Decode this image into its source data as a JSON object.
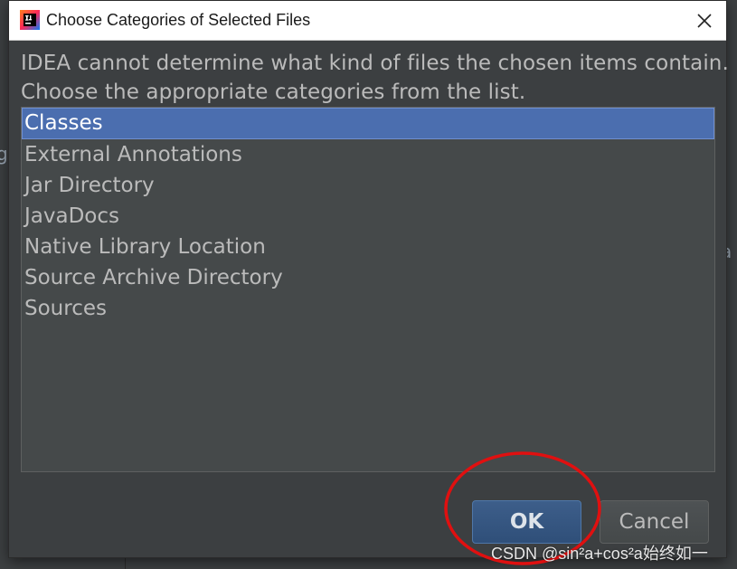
{
  "dialog": {
    "title": "Choose Categories of Selected Files",
    "app_icon": "intellij-idea-icon",
    "close_icon": "close-icon",
    "message_line1": "IDEA cannot determine what kind of files the chosen items contain.",
    "message_line2": "Choose the appropriate categories from the list.",
    "categories": [
      {
        "label": "Classes",
        "selected": true
      },
      {
        "label": "External Annotations",
        "selected": false
      },
      {
        "label": "Jar Directory",
        "selected": false
      },
      {
        "label": "JavaDocs",
        "selected": false
      },
      {
        "label": "Native Library Location",
        "selected": false
      },
      {
        "label": "Source Archive Directory",
        "selected": false
      },
      {
        "label": "Sources",
        "selected": false
      }
    ],
    "ok_label": "OK",
    "cancel_label": "Cancel"
  },
  "background": {
    "left_fragment": "g",
    "right_fragment": "a"
  },
  "annotation": {
    "color": "#e01010",
    "shape": "ellipse around OK button"
  },
  "watermark": "CSDN @sin²a+cos²a始终如一",
  "colors": {
    "panel": "#3c3f41",
    "list_bg": "#45494a",
    "selection": "#4b6eaf",
    "text": "#bbbbbb",
    "ok_button": "#365880"
  }
}
